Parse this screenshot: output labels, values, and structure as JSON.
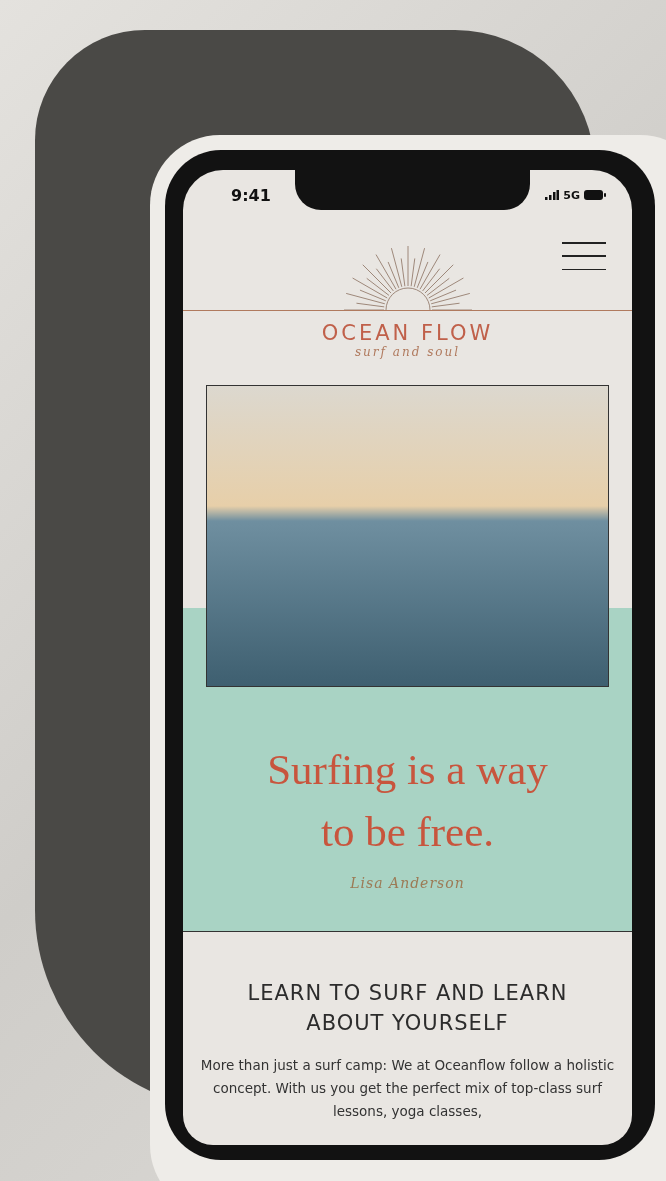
{
  "status_bar": {
    "time": "9:41",
    "network": "5G"
  },
  "header": {
    "brand": "OCEAN FLOW",
    "tagline": "surf and soul"
  },
  "hero": {
    "quote": "Surfing is a way to be free.",
    "signature": "Lisa Anderson"
  },
  "intro": {
    "heading": "LEARN TO SURF AND LEARN ABOUT YOURSELF",
    "text": "More than just a surf camp: We at Oceanflow follow a holistic concept. With us you get the perfect mix of top-class surf lessons, yoga classes,"
  }
}
